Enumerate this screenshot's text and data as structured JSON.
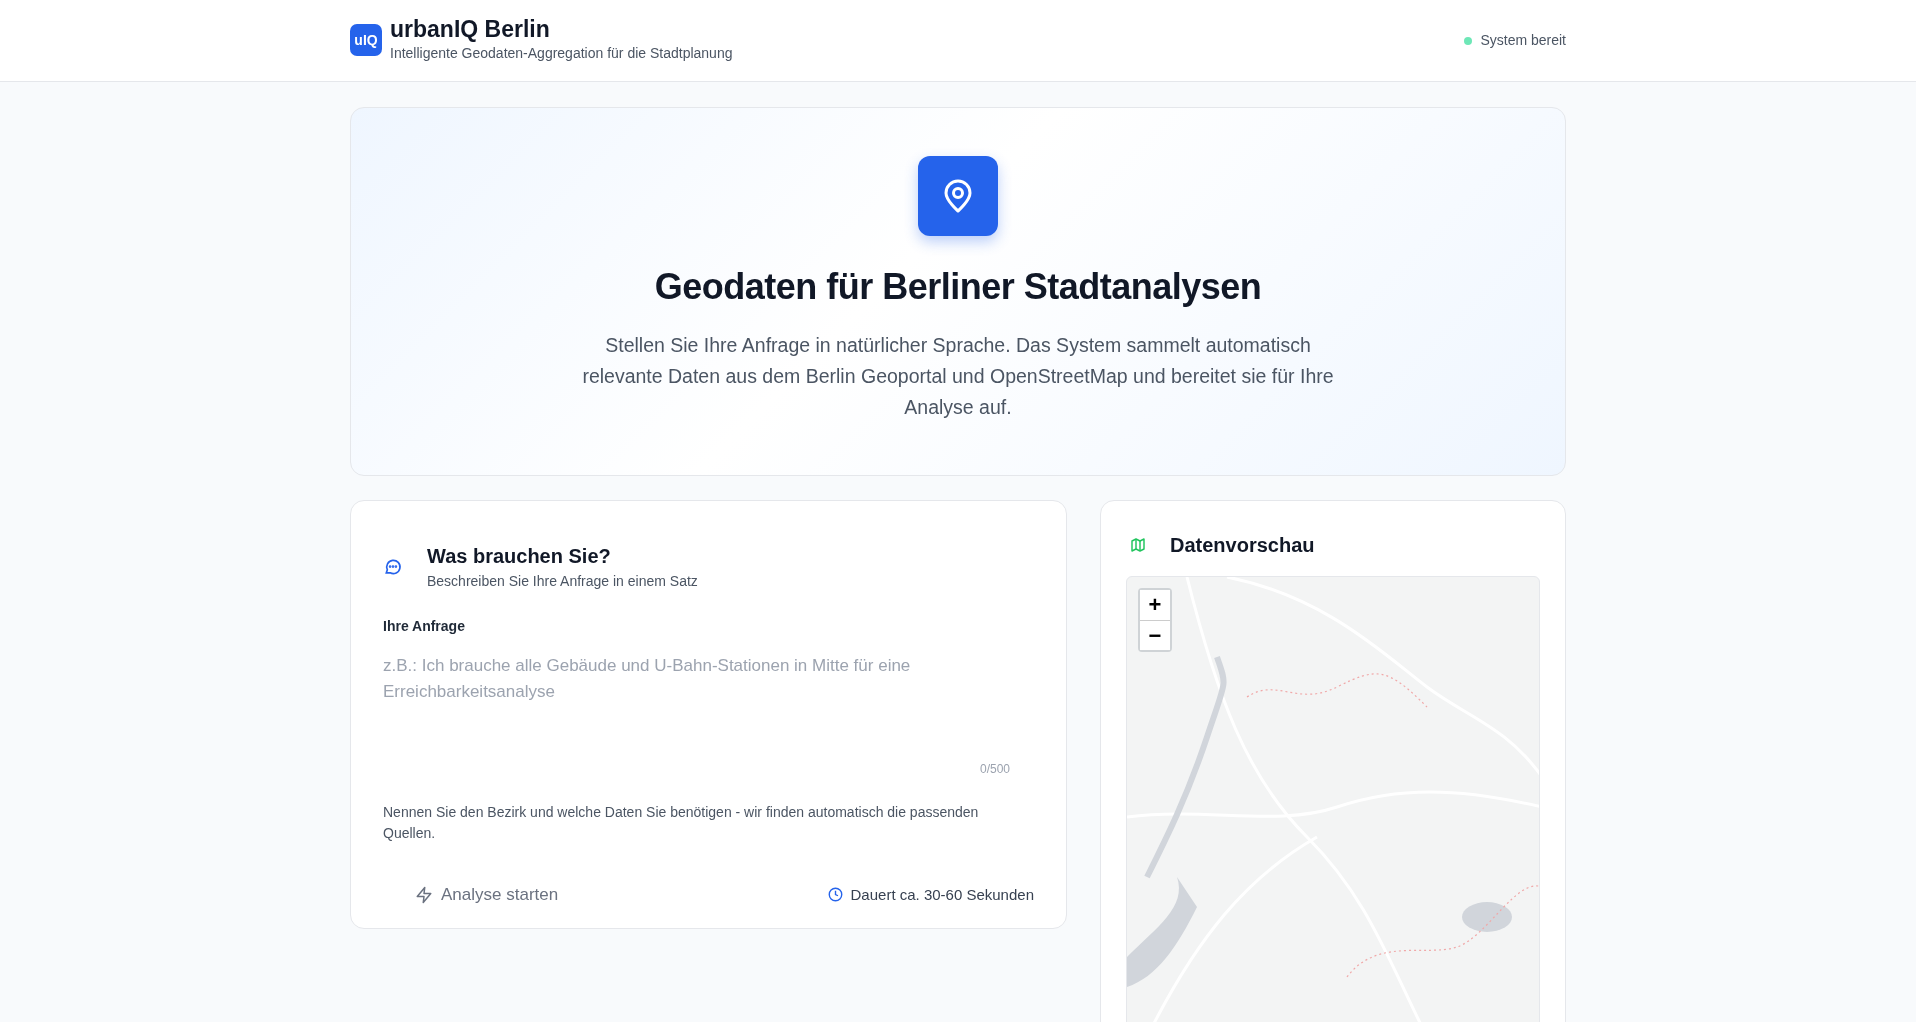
{
  "header": {
    "logo": "uIQ",
    "title": "urbanIQ Berlin",
    "subtitle": "Intelligente Geodaten-Aggregation für die Stadtplanung",
    "status": {
      "label": "System bereit",
      "ready": true
    }
  },
  "hero": {
    "title": "Geodaten für Berliner Stadtanalysen",
    "text": "Stellen Sie Ihre Anfrage in natürlicher Sprache. Das System sammelt automatisch relevante Daten aus dem Berlin Geoportal und OpenStreetMap und bereitet sie für Ihre Analyse auf."
  },
  "query_card": {
    "title": "Was brauchen Sie?",
    "subtitle": "Beschreiben Sie Ihre Anfrage in einem Satz",
    "field_label": "Ihre Anfrage",
    "placeholder": "z.B.: Ich brauche alle Gebäude und U-Bahn-Stationen in Mitte für eine Erreichbarkeitsanalyse",
    "counter": "0/500",
    "hint": "Nennen Sie den Bezirk und welche Daten Sie benötigen - wir finden automatisch die passenden Quellen.",
    "button": {
      "label": "Analyse starten",
      "disabled": true
    },
    "duration": "Dauert ca. 30-60 Sekunden"
  },
  "preview_card": {
    "title": "Datenvorschau",
    "zoom_in": "+",
    "zoom_out": "−"
  }
}
